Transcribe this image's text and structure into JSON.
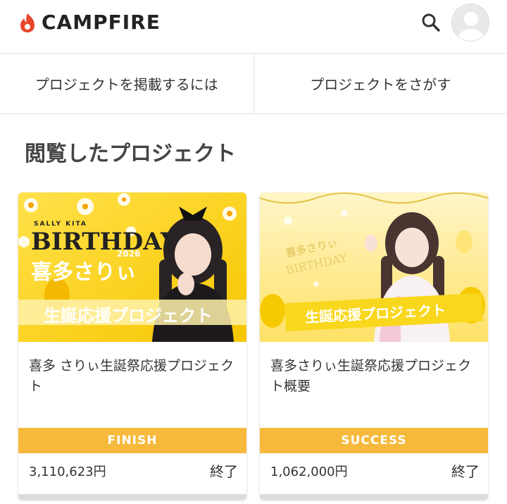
{
  "header": {
    "logo_text": "CAMPFIRE",
    "brand_color": "#e8452c"
  },
  "nav": {
    "items": [
      {
        "label": "プロジェクトを掲載するには"
      },
      {
        "label": "プロジェクトをさがす"
      }
    ]
  },
  "section": {
    "title": "閲覧したプロジェクト"
  },
  "projects": [
    {
      "title": "喜多 さりぃ生誕祭応援プロジェクト",
      "status": "FINISH",
      "amount": "3,110,623円",
      "state": "終了",
      "thumb": {
        "small_name": "SALLY KITA",
        "headline": "BIRTHDAY",
        "year": "2026",
        "name": "喜多さりぃ",
        "banner": "生誕応援プロジェクト"
      }
    },
    {
      "title": "喜多さりぃ生誕祭応援プロジェクト概要",
      "status": "SUCCESS",
      "amount": "1,062,000円",
      "state": "終了",
      "thumb": {
        "name": "喜多さりぃ",
        "headline": "BIRTHDAY",
        "banner": "生誕応援プロジェクト"
      }
    }
  ],
  "colors": {
    "status_bar": "#f6b93b",
    "accent_yellow": "#f9d71c"
  }
}
